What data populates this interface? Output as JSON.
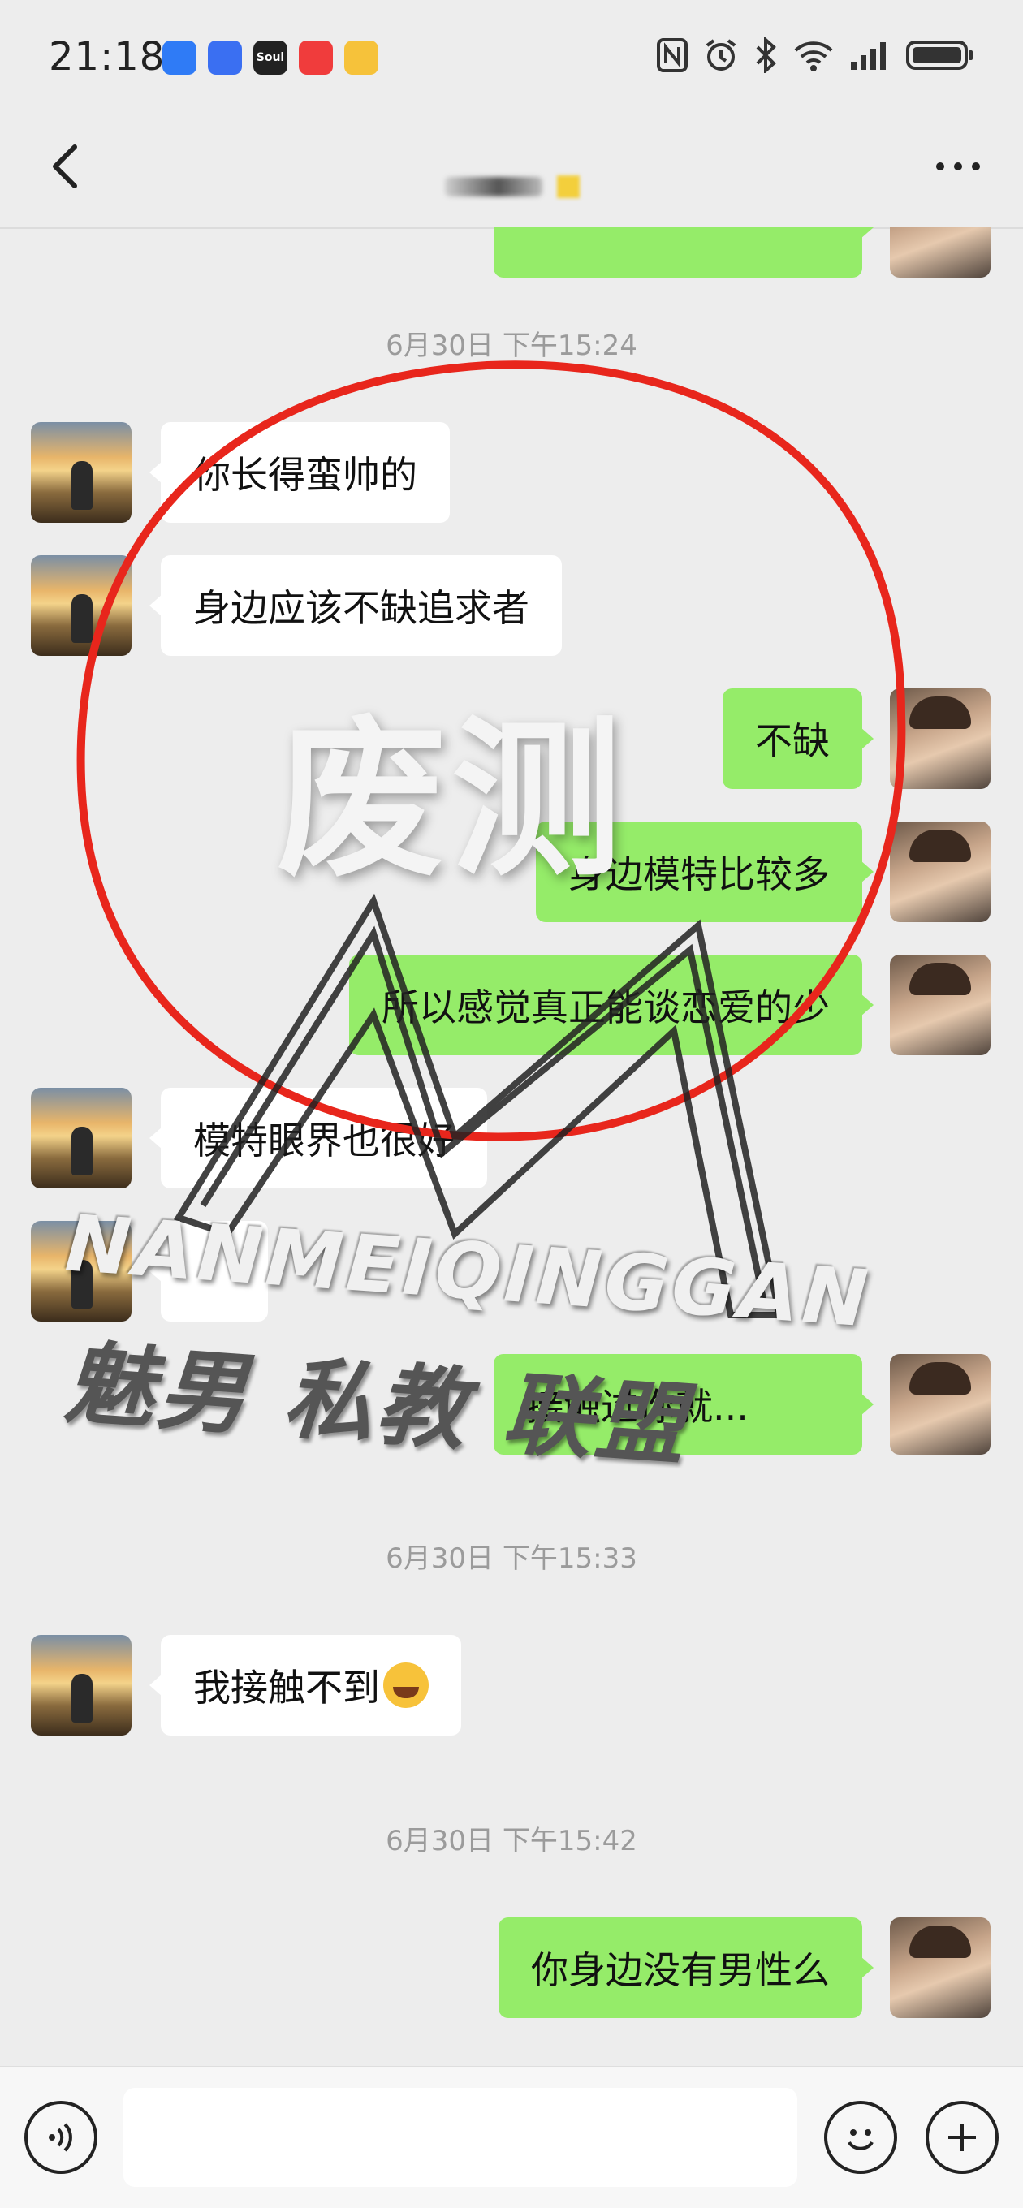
{
  "status_bar": {
    "time": "21:18",
    "app_icons": [
      {
        "icon": "blue-app-icon",
        "color": "#2f7bf6",
        "label": ""
      },
      {
        "icon": "baidu-app-icon",
        "color": "#3a6ff2",
        "label": ""
      },
      {
        "icon": "soul-app-icon",
        "color": "#222222",
        "label": "Soul"
      },
      {
        "icon": "red-app-icon",
        "color": "#f03c3c",
        "label": ""
      },
      {
        "icon": "weibo-app-icon",
        "color": "#f6c23a",
        "label": ""
      }
    ],
    "system_icons": [
      "nfc-icon",
      "alarm-icon",
      "bluetooth-icon",
      "wifi-icon",
      "signal-icon",
      "battery-icon"
    ]
  },
  "nav": {
    "back_icon": "chevron-left-icon",
    "title_redacted": true,
    "more_icon": "more-dots-icon"
  },
  "messages": [
    {
      "type": "timestamp",
      "text": "6月30日 下午15:24"
    },
    {
      "type": "msg",
      "side": "left",
      "text": "你长得蛮帅的"
    },
    {
      "type": "msg",
      "side": "left",
      "text": "身边应该不缺追求者"
    },
    {
      "type": "msg",
      "side": "right",
      "text": "不缺"
    },
    {
      "type": "msg",
      "side": "right",
      "text": "身边模特比较多"
    },
    {
      "type": "msg",
      "side": "right",
      "text": "所以感觉真正能谈恋爱的少"
    },
    {
      "type": "msg",
      "side": "left",
      "text": "模特眼界也很好"
    },
    {
      "type": "msg",
      "side": "right",
      "text": "接触过你就..."
    },
    {
      "type": "timestamp",
      "text": "6月30日 下午15:33"
    },
    {
      "type": "msg",
      "side": "left",
      "text": "我接触不到",
      "emoji": "tears-of-joy-emoji"
    },
    {
      "type": "timestamp",
      "text": "6月30日 下午15:42"
    },
    {
      "type": "msg",
      "side": "right",
      "text": "你身边没有男性么"
    }
  ],
  "overlay": {
    "stamp_text": "废测",
    "watermark_en": "NANMEIQINGGAN",
    "watermark_cn": "魅男 私教 联盟",
    "circle_color": "#e8261c"
  },
  "colors": {
    "bg": "#ededed",
    "bubble_mine": "#95ec69",
    "bubble_other": "#ffffff"
  },
  "input_bar": {
    "voice_icon": "voice-icon",
    "input_value": "",
    "emoji_icon": "emoji-face-icon",
    "plus_icon": "plus-icon"
  }
}
